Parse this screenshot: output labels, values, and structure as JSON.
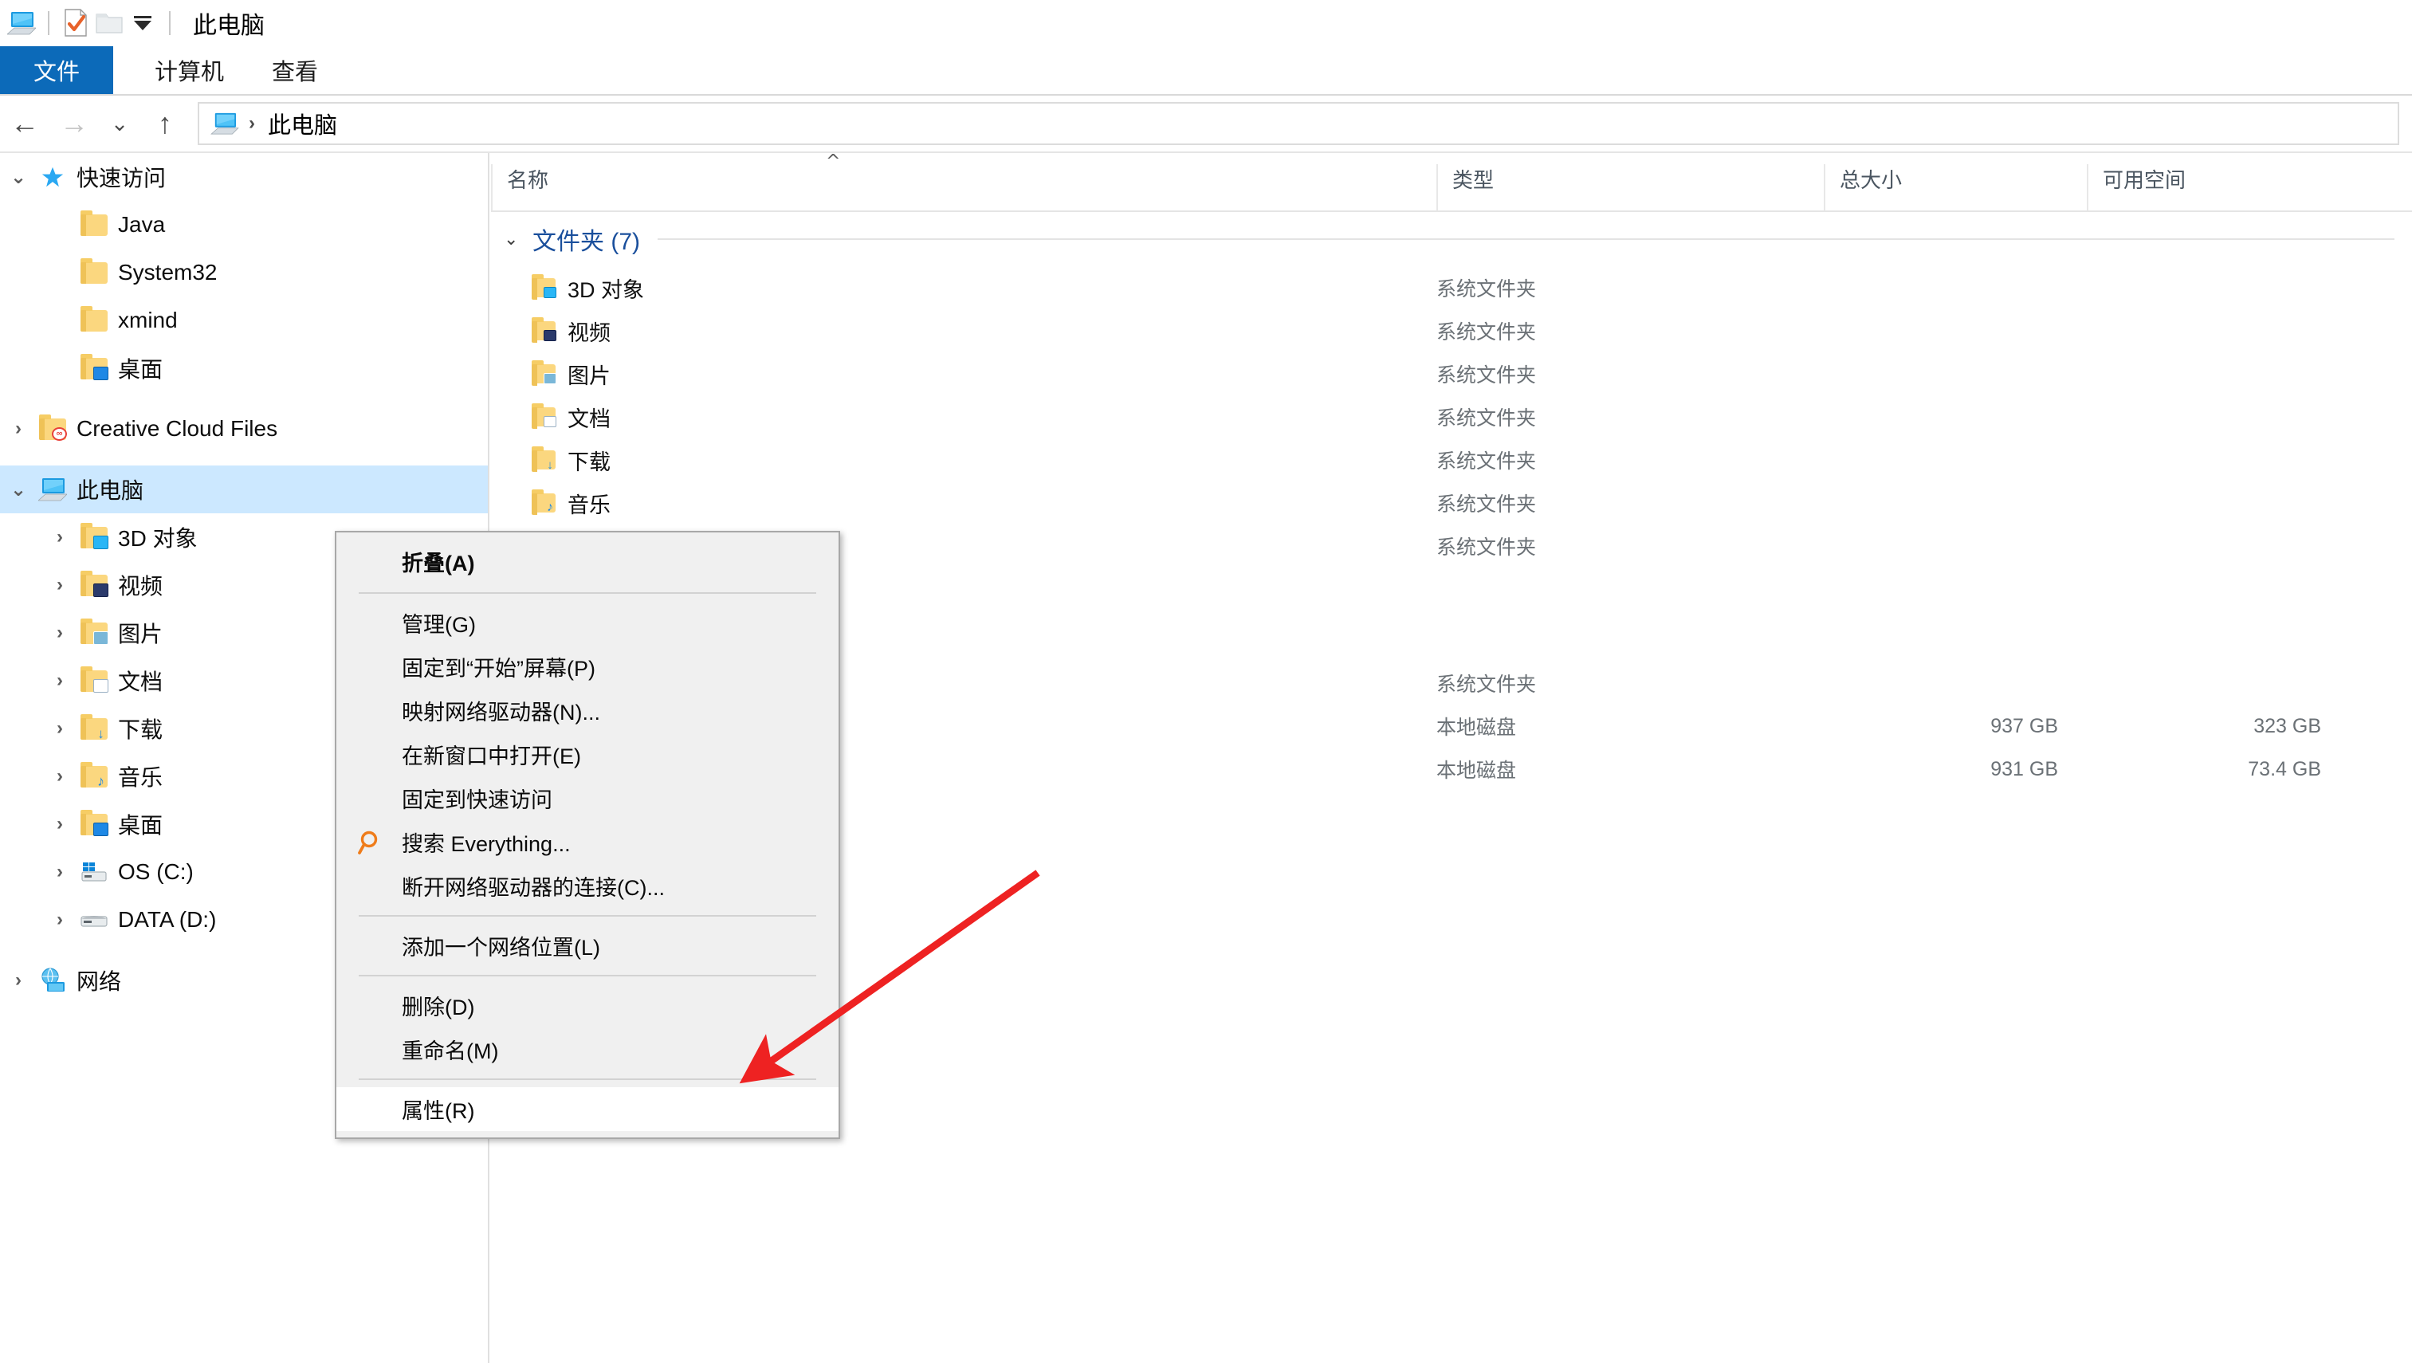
{
  "window": {
    "title": "此电脑",
    "quick_access_toolbar": [
      {
        "name": "this-pc-icon",
        "label": "此电脑"
      },
      {
        "name": "properties-icon",
        "label": "属性"
      },
      {
        "name": "new-folder-icon",
        "label": "新建文件夹"
      },
      {
        "name": "customize-qat-dropdown-icon",
        "label": "自定义快速访问工具栏"
      }
    ]
  },
  "ribbon": {
    "tabs": [
      {
        "label": "文件",
        "active": true
      },
      {
        "label": "计算机",
        "active": false
      },
      {
        "label": "查看",
        "active": false
      }
    ],
    "active_tab_color": "#0c6ab9"
  },
  "address_bar": {
    "back_label": "返回",
    "forward_label": "前进",
    "recent_label": "最近浏览的位置",
    "up_label": "上移一级",
    "breadcrumb": [
      "此电脑"
    ],
    "separator": "›"
  },
  "sidebar": {
    "items": [
      {
        "label": "快速访问",
        "icon": "star-icon",
        "indent": 0,
        "chevron": "expanded",
        "selected": false
      },
      {
        "label": "Java",
        "icon": "folder-icon",
        "indent": 1,
        "chevron": "none",
        "selected": false
      },
      {
        "label": "System32",
        "icon": "folder-icon",
        "indent": 1,
        "chevron": "none",
        "selected": false
      },
      {
        "label": "xmind",
        "icon": "folder-icon",
        "indent": 1,
        "chevron": "none",
        "selected": false
      },
      {
        "label": "桌面",
        "icon": "desktop-folder-icon",
        "indent": 1,
        "chevron": "none",
        "selected": false
      },
      {
        "label": "Creative Cloud Files",
        "icon": "creative-cloud-icon",
        "indent": 0,
        "chevron": "collapsed",
        "selected": false
      },
      {
        "label": "此电脑",
        "icon": "this-pc-icon",
        "indent": 0,
        "chevron": "expanded",
        "selected": true
      },
      {
        "label": "3D 对象",
        "icon": "3d-objects-icon",
        "indent": 1,
        "chevron": "collapsed",
        "selected": false
      },
      {
        "label": "视频",
        "icon": "videos-icon",
        "indent": 1,
        "chevron": "collapsed",
        "selected": false
      },
      {
        "label": "图片",
        "icon": "pictures-icon",
        "indent": 1,
        "chevron": "collapsed",
        "selected": false
      },
      {
        "label": "文档",
        "icon": "documents-icon",
        "indent": 1,
        "chevron": "collapsed",
        "selected": false
      },
      {
        "label": "下载",
        "icon": "downloads-icon",
        "indent": 1,
        "chevron": "collapsed",
        "selected": false
      },
      {
        "label": "音乐",
        "icon": "music-icon",
        "indent": 1,
        "chevron": "collapsed",
        "selected": false
      },
      {
        "label": "桌面",
        "icon": "desktop-folder-icon",
        "indent": 1,
        "chevron": "collapsed",
        "selected": false
      },
      {
        "label": "OS (C:)",
        "icon": "os-drive-icon",
        "indent": 1,
        "chevron": "collapsed",
        "selected": false
      },
      {
        "label": "DATA (D:)",
        "icon": "drive-icon",
        "indent": 1,
        "chevron": "collapsed",
        "selected": false
      },
      {
        "label": "网络",
        "icon": "network-icon",
        "indent": 0,
        "chevron": "collapsed",
        "selected": false
      }
    ],
    "selection_color": "#cce8ff"
  },
  "file_list": {
    "columns": [
      {
        "label": "名称",
        "key": "name"
      },
      {
        "label": "类型",
        "key": "type"
      },
      {
        "label": "总大小",
        "key": "size"
      },
      {
        "label": "可用空间",
        "key": "free"
      }
    ],
    "sort_indicator": "^",
    "groups": [
      {
        "label": "文件夹 (7)",
        "chevron": "expanded"
      }
    ],
    "rows": [
      {
        "name": "3D 对象",
        "icon": "3d-objects-icon",
        "type": "系统文件夹",
        "size": "",
        "free": ""
      },
      {
        "name": "视频",
        "icon": "videos-icon",
        "type": "系统文件夹",
        "size": "",
        "free": ""
      },
      {
        "name": "图片",
        "icon": "pictures-icon",
        "type": "系统文件夹",
        "size": "",
        "free": ""
      },
      {
        "name": "文档",
        "icon": "documents-icon",
        "type": "系统文件夹",
        "size": "",
        "free": ""
      },
      {
        "name": "下载",
        "icon": "downloads-icon",
        "type": "系统文件夹",
        "size": "",
        "free": ""
      },
      {
        "name": "音乐",
        "icon": "music-icon",
        "type": "系统文件夹",
        "size": "",
        "free": ""
      },
      {
        "name": "",
        "icon": "desktop-folder-icon",
        "type": "系统文件夹",
        "size": "",
        "free": ""
      }
    ],
    "drive_rows": [
      {
        "name": "",
        "icon": "os-drive-icon",
        "type": "本地磁盘",
        "size": "937 GB",
        "free": "323 GB"
      },
      {
        "name": "",
        "icon": "drive-icon",
        "type": "本地磁盘",
        "size": "931 GB",
        "free": "73.4 GB"
      }
    ]
  },
  "context_menu": {
    "items": [
      {
        "label": "折叠(A)",
        "bold": true,
        "icon": null,
        "hover": false
      },
      {
        "type": "separator"
      },
      {
        "label": "管理(G)",
        "bold": false,
        "icon": null,
        "hover": false
      },
      {
        "label": "固定到“开始”屏幕(P)",
        "bold": false,
        "icon": null,
        "hover": false
      },
      {
        "label": "映射网络驱动器(N)...",
        "bold": false,
        "icon": null,
        "hover": false
      },
      {
        "label": "在新窗口中打开(E)",
        "bold": false,
        "icon": null,
        "hover": false
      },
      {
        "label": "固定到快速访问",
        "bold": false,
        "icon": null,
        "hover": false
      },
      {
        "label": "搜索 Everything...",
        "bold": false,
        "icon": "search-icon",
        "hover": false
      },
      {
        "label": "断开网络驱动器的连接(C)...",
        "bold": false,
        "icon": null,
        "hover": false
      },
      {
        "type": "separator"
      },
      {
        "label": "添加一个网络位置(L)",
        "bold": false,
        "icon": null,
        "hover": false
      },
      {
        "type": "separator"
      },
      {
        "label": "删除(D)",
        "bold": false,
        "icon": null,
        "hover": false
      },
      {
        "label": "重命名(M)",
        "bold": false,
        "icon": null,
        "hover": false
      },
      {
        "type": "separator"
      },
      {
        "label": "属性(R)",
        "bold": false,
        "icon": null,
        "hover": true
      }
    ],
    "background_color": "#f0f0f0",
    "hover_color": "#ffffff"
  },
  "annotation": {
    "arrow_color": "#ee2222",
    "points_to": "属性(R)"
  }
}
